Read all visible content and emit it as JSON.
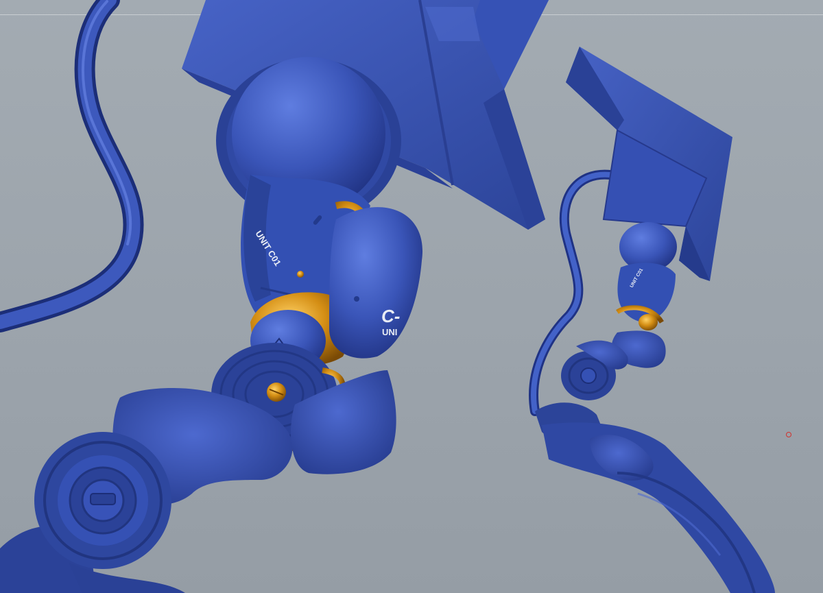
{
  "viewport": {
    "background": "#9aa2aa",
    "model_color": "#3a55b0",
    "accent_color": "#d89a1e"
  },
  "decals": {
    "unit_label": "UNIT C01",
    "unit_label_small": "UNIT C01",
    "side_letter": "C-",
    "sub_letters": "UNI"
  },
  "marker": {
    "icon": "circle-marker-icon"
  }
}
